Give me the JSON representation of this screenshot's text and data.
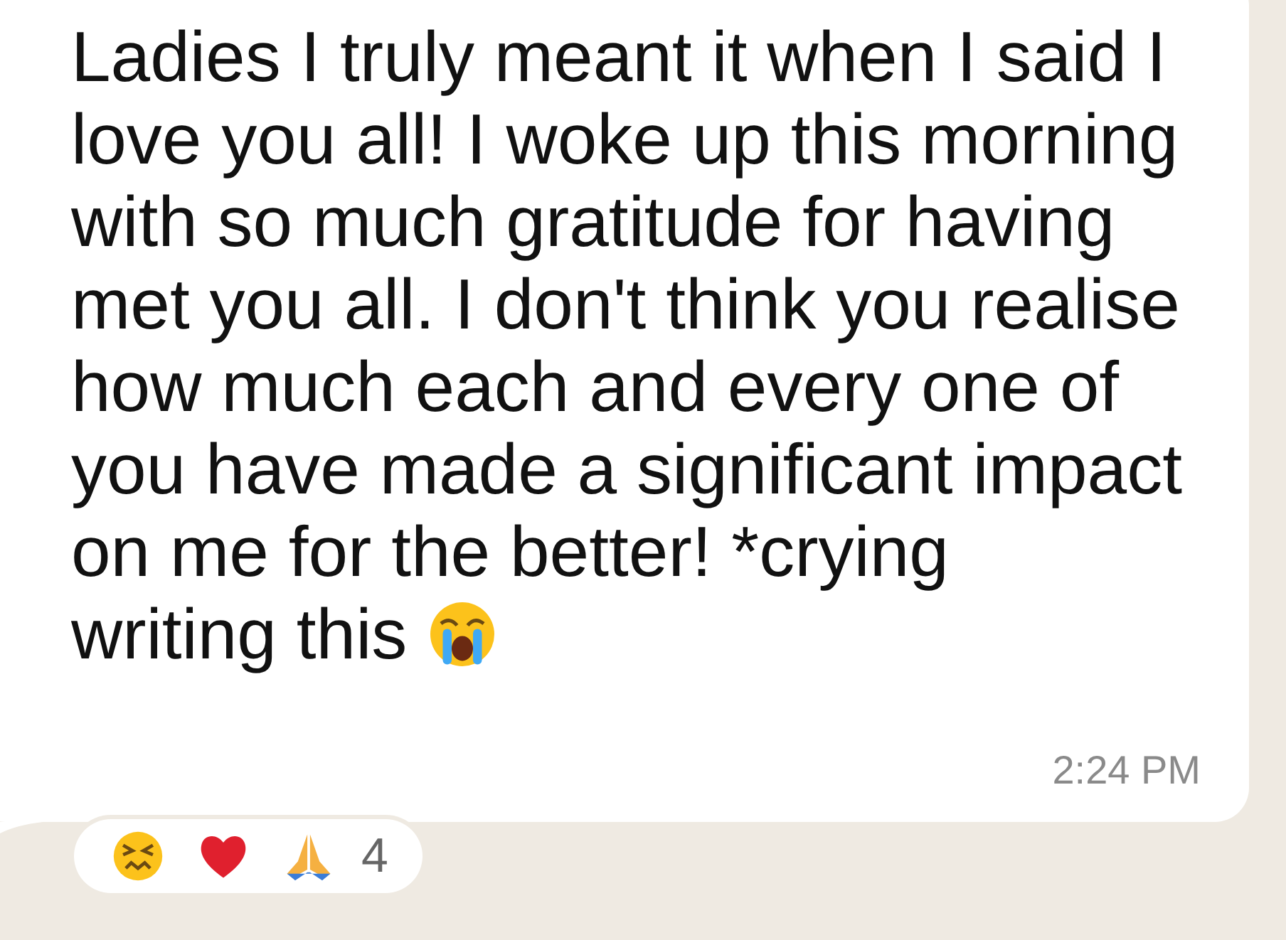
{
  "message": {
    "lines": [
      "Ladies I truly meant it when I said I",
      "love you all! I woke up this morning",
      "with so much gratitude for having",
      "met you all. I don't think you realise",
      "how much each and every one of",
      "you have made a significant impact",
      "on me for the better! *crying",
      "writing this"
    ],
    "time": "2:24 PM"
  },
  "reactions": {
    "emojis": [
      {
        "kind": "confounded"
      },
      {
        "kind": "heart"
      },
      {
        "kind": "pray"
      }
    ],
    "count": "4"
  }
}
